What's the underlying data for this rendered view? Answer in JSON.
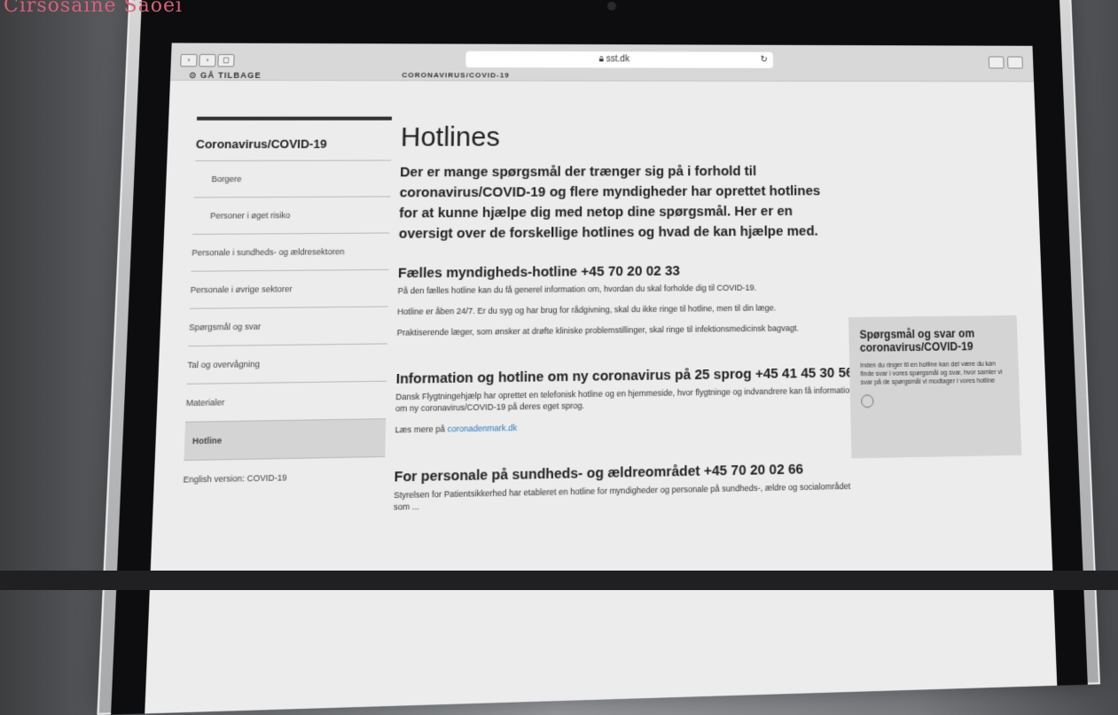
{
  "caption": "Cirsosaine Saoei",
  "browser": {
    "address": "sst.dk",
    "reload_icon": "reload-icon"
  },
  "page": {
    "back_label": "GÅ TILBAGE",
    "breadcrumb": "CORONAVIRUS/COVID-19",
    "title": "Hotlines",
    "intro": "Der er mange spørgsmål der trænger sig på i forhold til coronavirus/COVID-19 og flere myndigheder har oprettet hotlines for at kunne hjælpe dig med netop dine spørgsmål. Her er en oversigt over de forskellige hotlines og hvad de kan hjælpe med."
  },
  "sidebar": {
    "title": "Coronavirus/COVID-19",
    "items": [
      {
        "label": "Borgere"
      },
      {
        "label": "Personer i øget risiko"
      },
      {
        "label": "Personale i sundheds- og ældresektoren"
      },
      {
        "label": "Personale i øvrige sektorer"
      },
      {
        "label": "Spørgsmål og svar"
      },
      {
        "label": "Tal og overvågning"
      },
      {
        "label": "Materialer"
      },
      {
        "label": "Hotline"
      },
      {
        "label": "English version: COVID-19"
      }
    ]
  },
  "sections": [
    {
      "heading": "Fælles myndigheds-hotline +45 70 20 02 33",
      "p1": "På den fælles hotline kan du få generel information om, hvordan du skal forholde dig til COVID-19.",
      "p2": "Hotline er åben 24/7. Er du syg og har brug for rådgivning, skal du ikke ringe til hotline, men til din læge.",
      "p3": "Praktiserende læger, som ønsker at drøfte kliniske problemstillinger, skal ringe til infektionsmedicinsk bagvagt."
    },
    {
      "heading": "Information og hotline om ny coronavirus på 25 sprog +45 41 45 30 56",
      "p1": "Dansk Flygtningehjælp har oprettet en telefonisk hotline og en hjemmeside, hvor flygtninge og indvandrere kan få information om ny coronavirus/COVID-19 på deres eget sprog.",
      "more_prefix": "Læs mere på",
      "more_link": "coronadenmark.dk"
    },
    {
      "heading": "For personale på sundheds- og ældreområdet +45 70 20 02 66",
      "p1": "Styrelsen for Patientsikkerhed har etableret en hotline for myndigheder og personale på sundheds-, ældre og socialområdet som ..."
    }
  ],
  "aside": {
    "title": "Spørgsmål og svar om coronavirus/COVID-19",
    "text": "Inden du ringer til en hotline kan det være du kan finde svar i vores spørgsmål og svar, hvor samler vi svar på de spørgsmål vi modtager i vores hotline"
  }
}
